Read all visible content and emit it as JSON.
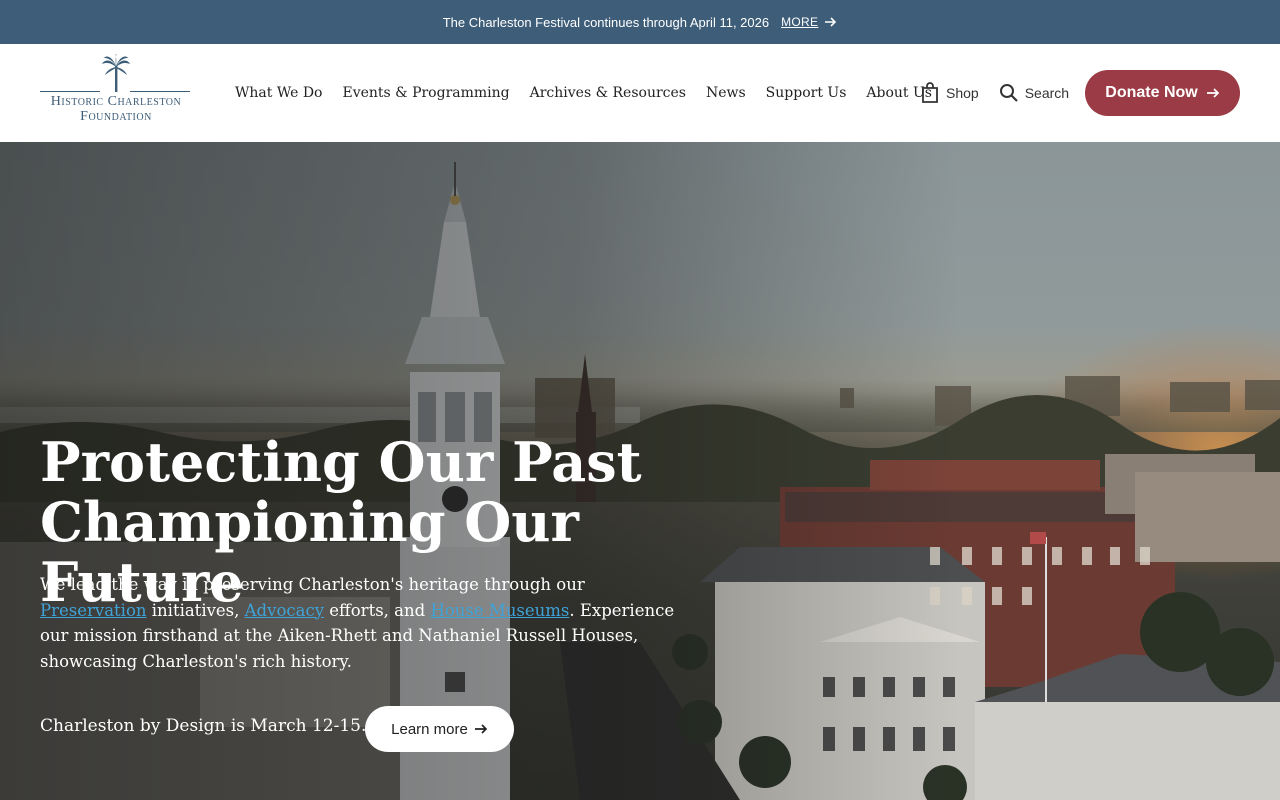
{
  "announcement": {
    "text": "The Charleston Festival continues through April 11, 2026",
    "more_label": "MORE"
  },
  "logo": {
    "line1": "Historic Charleston",
    "line2": "Foundation",
    "icon": "palmetto-tree-icon"
  },
  "nav": {
    "items": [
      {
        "label": "What We Do"
      },
      {
        "label": "Events & Programming"
      },
      {
        "label": "Archives & Resources"
      },
      {
        "label": "News"
      },
      {
        "label": "Support Us"
      },
      {
        "label": "About Us"
      }
    ]
  },
  "utility": {
    "shop_label": "Shop",
    "search_label": "Search",
    "donate_label": "Donate Now"
  },
  "hero": {
    "title_line1": "Protecting Our Past",
    "title_line2": "Championing Our Future",
    "body": {
      "part1": "We lead the way in preserving Charleston's heritage through our ",
      "link1": "Preservation",
      "part2": " initiatives, ",
      "link2": "Advocacy",
      "part3": " efforts, and ",
      "link3": "House Museums",
      "part4": ". Experience our mission firsthand at the Aiken-Rhett and Nathaniel Russell Houses, showcasing Charleston's rich history."
    },
    "cta_text": "Charleston by Design is March 12-15.",
    "cta_button": "Learn more"
  },
  "colors": {
    "announcement_bg": "#3d5d78",
    "donate_bg": "#9a3b45",
    "link": "#3fa3d8",
    "brand": "#3d5d78"
  }
}
